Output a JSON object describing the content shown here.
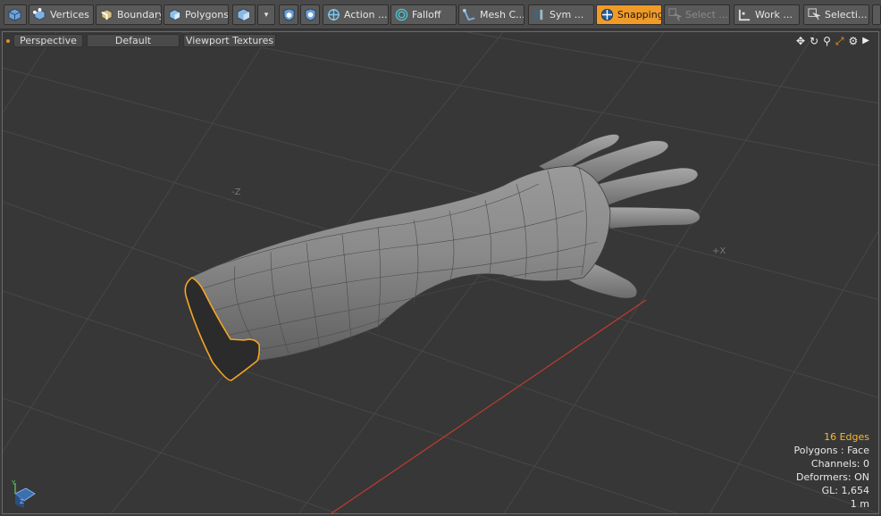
{
  "toolbar": {
    "items": [
      {
        "label": "",
        "icon": "item-mode-cube-icon"
      },
      {
        "label": "Vertices",
        "icon": "vertices-icon"
      },
      {
        "label": "Boundary",
        "icon": "boundary-icon"
      },
      {
        "label": "Polygons",
        "icon": "polygons-icon"
      },
      {
        "label": "",
        "icon": "material-cube-icon"
      },
      {
        "label": "▾",
        "icon": "dropdown-icon"
      },
      {
        "label": "",
        "icon": "shield-cube-icon"
      },
      {
        "label": "",
        "icon": "snap-cube-icon"
      },
      {
        "label": "Action ...",
        "icon": "action-center-icon"
      },
      {
        "label": "Falloff",
        "icon": "falloff-icon"
      },
      {
        "label": "Mesh C...",
        "icon": "mesh-constraint-icon"
      },
      {
        "label": "Sym ...",
        "icon": "symmetry-icon"
      },
      {
        "label": "Snapping",
        "icon": "snapping-icon"
      },
      {
        "label": "Select ...",
        "icon": "select-through-icon"
      },
      {
        "label": "Work ...",
        "icon": "work-plane-icon"
      },
      {
        "label": "Selecti...",
        "icon": "selection-sets-icon"
      }
    ]
  },
  "viewport": {
    "projection": "Perspective",
    "style": "Default",
    "shading": "Viewport Textures",
    "axis_labels": {
      "neg_z": "-Z",
      "pos_x": "+X"
    },
    "gizmo": {
      "y": "Y",
      "z": "Z"
    }
  },
  "stats": {
    "selection": "16 Edges",
    "polygons": "Polygons : Face",
    "channels": "Channels: 0",
    "deformers": "Deformers: ON",
    "gl": "GL: 1,654",
    "scale": "1 m"
  },
  "colors": {
    "accent": "#f09a28",
    "selection_edge": "#f5a623",
    "x_axis": "#c43a32"
  }
}
